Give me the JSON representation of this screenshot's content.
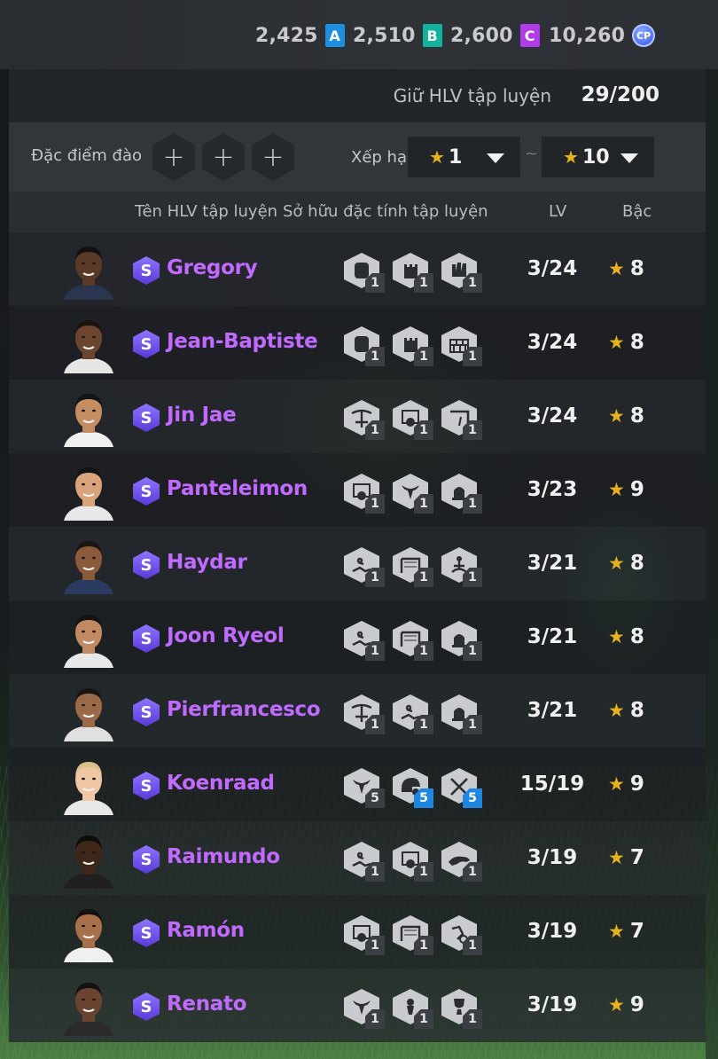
{
  "currencies": [
    {
      "value": "2,425",
      "icon": "A",
      "color": "#1e8fe0",
      "icon_name": "a-ticket-icon"
    },
    {
      "value": "2,510",
      "icon": "B",
      "color": "#10b39e",
      "icon_name": "b-ticket-icon"
    },
    {
      "value": "2,600",
      "icon": "C",
      "color": "#b13be8",
      "icon_name": "c-ticket-icon"
    },
    {
      "value": "10,260",
      "icon": "CP",
      "color": "#5270ee",
      "icon_name": "cp-coin-icon"
    }
  ],
  "holder": {
    "label": "Giữ HLV tập luyện",
    "value": "29/200"
  },
  "filters": {
    "traits_label": "Đặc điểm đào",
    "add_symbol": "+",
    "rank_label": "Xếp hạng",
    "rank_from": "1",
    "rank_to": "10",
    "separator": "~"
  },
  "columns": {
    "name": "Tên HLV tập luyện",
    "traits": "Sở hữu đặc tính tập luyện",
    "lv": "LV",
    "grade": "Bậc"
  },
  "accent": {
    "name_color": "#c06aff",
    "star_color": "#e8b21e",
    "s_badge": "#6e4cf0"
  },
  "coaches": [
    {
      "badge": "S",
      "name": "Gregory",
      "lv": "3/24",
      "grade": "8",
      "traits": [
        {
          "icon": "glove-fist-icon",
          "level": "1"
        },
        {
          "icon": "tower-icon",
          "level": "1"
        },
        {
          "icon": "glove-block-icon",
          "level": "1"
        }
      ]
    },
    {
      "badge": "S",
      "name": "Jean-Baptiste",
      "lv": "3/24",
      "grade": "8",
      "traits": [
        {
          "icon": "glove-fist-icon",
          "level": "1"
        },
        {
          "icon": "tower-icon",
          "level": "1"
        },
        {
          "icon": "wall-icon",
          "level": "1"
        }
      ]
    },
    {
      "badge": "S",
      "name": "Jin Jae",
      "lv": "3/24",
      "grade": "8",
      "traits": [
        {
          "icon": "crossbow-icon",
          "level": "1"
        },
        {
          "icon": "goal-ball-icon",
          "level": "1"
        },
        {
          "icon": "goal-corner-icon",
          "level": "1"
        }
      ]
    },
    {
      "badge": "S",
      "name": "Panteleimon",
      "lv": "3/23",
      "grade": "9",
      "traits": [
        {
          "icon": "goal-ball-icon",
          "level": "1"
        },
        {
          "icon": "bull-icon",
          "level": "1"
        },
        {
          "icon": "alarm-icon",
          "level": "1"
        }
      ]
    },
    {
      "badge": "S",
      "name": "Haydar",
      "lv": "3/21",
      "grade": "8",
      "traits": [
        {
          "icon": "slide-tackle-icon",
          "level": "1"
        },
        {
          "icon": "goal-net-icon",
          "level": "1"
        },
        {
          "icon": "meditate-icon",
          "level": "1"
        }
      ]
    },
    {
      "badge": "S",
      "name": "Joon Ryeol",
      "lv": "3/21",
      "grade": "8",
      "traits": [
        {
          "icon": "slide-tackle-icon",
          "level": "1"
        },
        {
          "icon": "goal-net-icon",
          "level": "1"
        },
        {
          "icon": "alarm-icon",
          "level": "1"
        }
      ]
    },
    {
      "badge": "S",
      "name": "Pierfrancesco",
      "lv": "3/21",
      "grade": "8",
      "traits": [
        {
          "icon": "crossbow-icon",
          "level": "1"
        },
        {
          "icon": "slide-tackle-icon",
          "level": "1"
        },
        {
          "icon": "alarm-icon",
          "level": "1"
        }
      ]
    },
    {
      "badge": "S",
      "name": "Koenraad",
      "lv": "15/19",
      "grade": "9",
      "traits": [
        {
          "icon": "bull-icon",
          "level": "5"
        },
        {
          "icon": "helmet-ball-icon",
          "level": "5",
          "blue": true
        },
        {
          "icon": "scissors-icon",
          "level": "5",
          "blue": true
        }
      ]
    },
    {
      "badge": "S",
      "name": "Raimundo",
      "lv": "3/19",
      "grade": "7",
      "traits": [
        {
          "icon": "slide-tackle-icon",
          "level": "1"
        },
        {
          "icon": "goal-ball-icon",
          "level": "1"
        },
        {
          "icon": "panther-icon",
          "level": "1"
        }
      ]
    },
    {
      "badge": "S",
      "name": "Ramón",
      "lv": "3/19",
      "grade": "7",
      "traits": [
        {
          "icon": "goal-ball-icon",
          "level": "1"
        },
        {
          "icon": "goal-net-icon",
          "level": "1"
        },
        {
          "icon": "dribble-icon",
          "level": "1"
        }
      ]
    },
    {
      "badge": "S",
      "name": "Renato",
      "lv": "3/19",
      "grade": "9",
      "traits": [
        {
          "icon": "bull-icon",
          "level": "1"
        },
        {
          "icon": "trophy-ball-icon",
          "level": "1"
        },
        {
          "icon": "trophy-icon",
          "level": "1"
        }
      ]
    }
  ]
}
